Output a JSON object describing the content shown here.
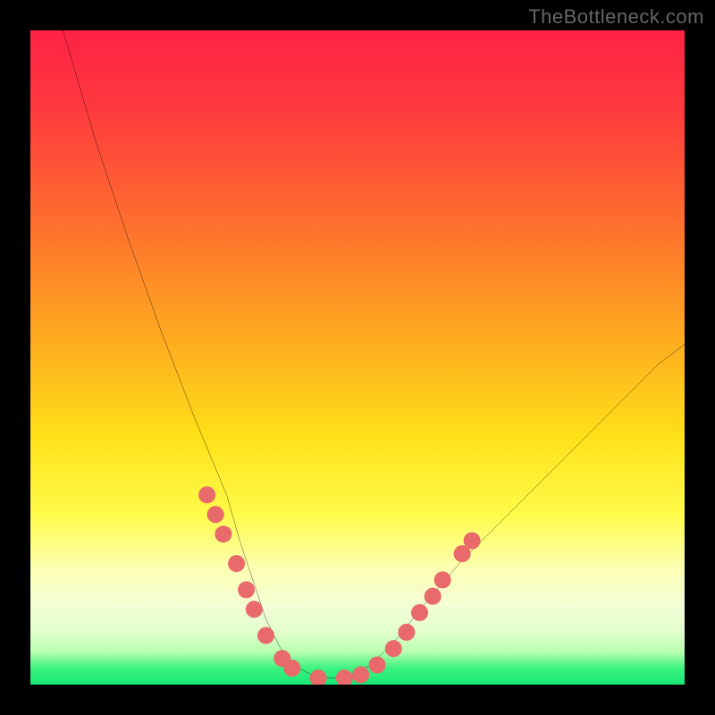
{
  "watermark": "TheBottleneck.com",
  "chart_data": {
    "type": "line",
    "title": "",
    "xlabel": "",
    "ylabel": "",
    "xlim": [
      0,
      100
    ],
    "ylim": [
      0,
      100
    ],
    "series": [
      {
        "name": "curve",
        "x": [
          5,
          10,
          15,
          20,
          25,
          30,
          32,
          34,
          36,
          38,
          40,
          44,
          48,
          52,
          56,
          60,
          66,
          72,
          78,
          84,
          90,
          96,
          100
        ],
        "y": [
          100,
          83,
          68,
          54,
          41,
          29,
          22,
          16,
          10,
          6,
          3,
          1,
          1,
          3,
          7,
          12,
          19,
          25,
          31,
          37,
          43,
          49,
          52
        ]
      }
    ],
    "markers": [
      {
        "x": 27,
        "y": 29
      },
      {
        "x": 28.3,
        "y": 26
      },
      {
        "x": 29.5,
        "y": 23
      },
      {
        "x": 31.5,
        "y": 18.5
      },
      {
        "x": 33,
        "y": 14.5
      },
      {
        "x": 34.2,
        "y": 11.5
      },
      {
        "x": 36,
        "y": 7.5
      },
      {
        "x": 38.5,
        "y": 4
      },
      {
        "x": 40,
        "y": 2.5
      },
      {
        "x": 44,
        "y": 1
      },
      {
        "x": 48,
        "y": 1
      },
      {
        "x": 50.5,
        "y": 1.5
      },
      {
        "x": 53,
        "y": 3
      },
      {
        "x": 55.5,
        "y": 5.5
      },
      {
        "x": 57.5,
        "y": 8
      },
      {
        "x": 59.5,
        "y": 11
      },
      {
        "x": 61.5,
        "y": 13.5
      },
      {
        "x": 63,
        "y": 16
      },
      {
        "x": 66,
        "y": 20
      },
      {
        "x": 67.5,
        "y": 22
      }
    ],
    "colors": {
      "curve": "#000000",
      "marker": "#e86a6a",
      "gradient_top": "#fe2244",
      "gradient_bottom": "#17e877"
    }
  }
}
